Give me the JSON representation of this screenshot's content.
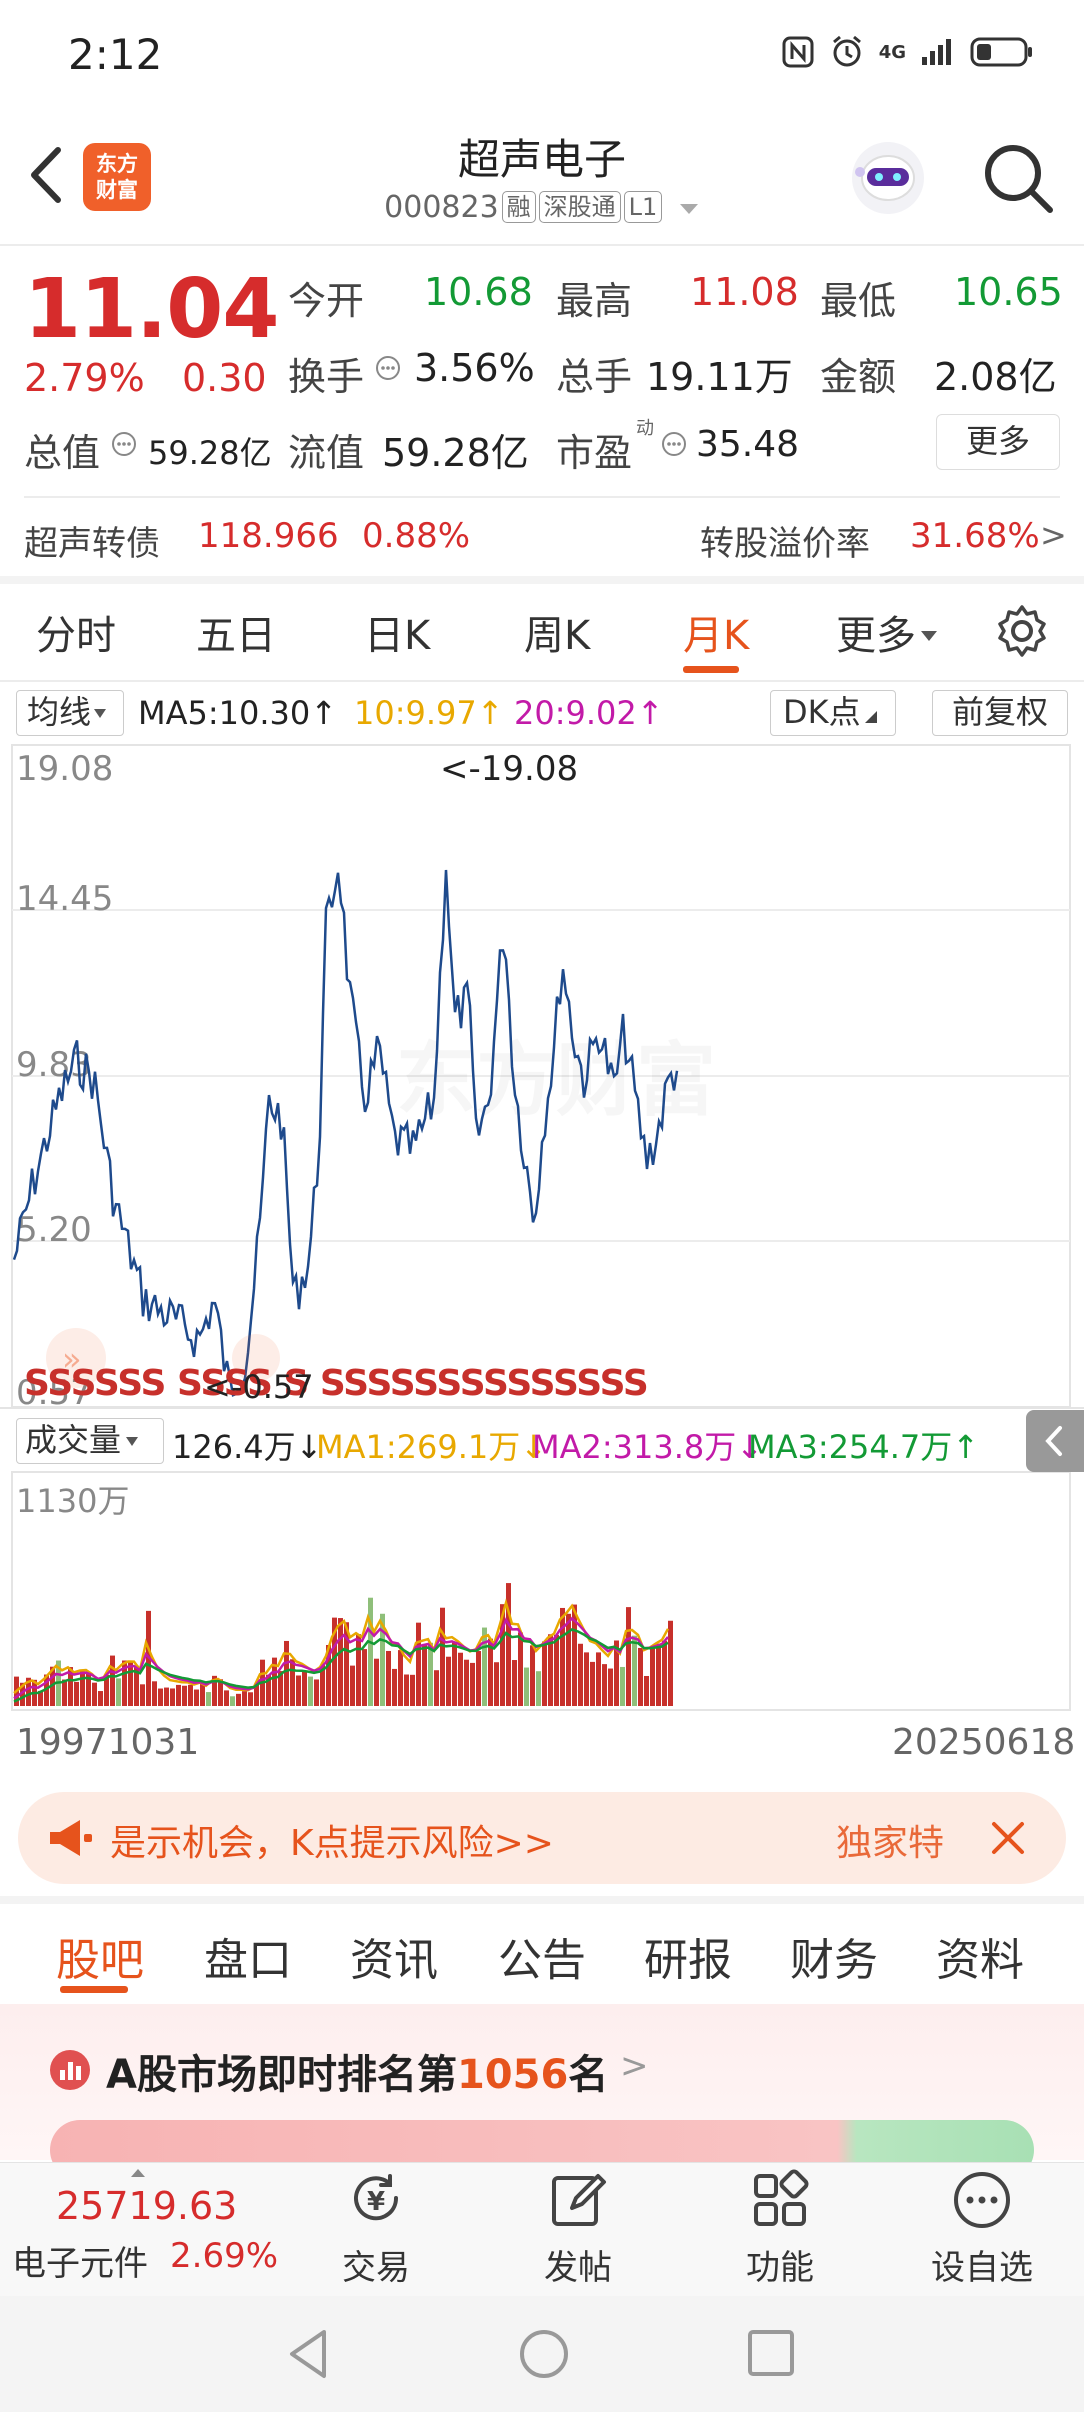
{
  "status_bar": {
    "time": "2:12",
    "network": "4G"
  },
  "header": {
    "logo_line1": "东方",
    "logo_line2": "财富",
    "title": "超声电子",
    "code": "000823",
    "tags": [
      "融",
      "深股通",
      "L1"
    ]
  },
  "quote": {
    "price": "11.04",
    "change_pct": "2.79%",
    "change_amt": "0.30",
    "open_label": "今开",
    "open": "10.68",
    "high_label": "最高",
    "high": "11.08",
    "low_label": "最低",
    "low": "10.65",
    "turnover_label": "换手",
    "turnover": "3.56%",
    "volume_label": "总手",
    "volume": "19.11万",
    "amount_label": "金额",
    "amount": "2.08亿",
    "mktcap_label": "总值",
    "mktcap": "59.28亿",
    "float_label": "流值",
    "float_cap": "59.28亿",
    "pe_label": "市盈",
    "pe_sup": "动",
    "pe": "35.48",
    "more_button": "更多"
  },
  "bond": {
    "label": "超声转债",
    "price": "118.966",
    "pct": "0.88%",
    "premium_label": "转股溢价率",
    "premium": "31.68%",
    "arrow": ">"
  },
  "period_tabs": [
    "分时",
    "五日",
    "日K",
    "周K",
    "月K",
    "更多"
  ],
  "active_period": "月K",
  "chart_toolbar": {
    "ma_select": "均线",
    "ma5": "MA5:10.30↑",
    "ma10": "10:9.97↑",
    "ma20": "20:9.02↑",
    "dk_button": "DK点",
    "adjust_button": "前复权",
    "ma10_color": "#e8a800",
    "ma20_color": "#c21aa8"
  },
  "price_chart": {
    "y_labels": [
      "19.08",
      "14.45",
      "9.83",
      "5.20",
      "0.57"
    ],
    "max_marker": "<-19.08",
    "min_marker": "<-0.57",
    "signal_text": "SSSSSS  SSSS S SSSSSSSSSSSSSS",
    "line_color": "#1e4a8c",
    "watermark": "东方财富"
  },
  "volume_toolbar": {
    "select": "成交量",
    "vol": "126.4万↓",
    "ma1": "MA1:269.1万↓",
    "ma2": "MA2:313.8万↓",
    "ma3": "MA3:254.7万↑",
    "ma1_color": "#e8a800",
    "ma2_color": "#c21aa8",
    "ma3_color": "#139a35"
  },
  "volume_chart": {
    "y_label": "1130万",
    "start_date": "19971031",
    "end_date": "20250618"
  },
  "banner": {
    "text": "是示机会，K点提示风险>>",
    "right_text": "独家特"
  },
  "bottom_tabs": [
    "股吧",
    "盘口",
    "资讯",
    "公告",
    "研报",
    "财务",
    "资料"
  ],
  "active_bottom_tab": "股吧",
  "ranking": {
    "prefix": "A股市场即时排名第",
    "rank": "1056",
    "suffix": "名",
    "arrow": ">"
  },
  "bottom_bar": {
    "index_value": "25719.63",
    "sector_name": "电子元件",
    "sector_pct": "2.69%",
    "items": [
      "交易",
      "发帖",
      "功能",
      "设自选"
    ]
  }
}
